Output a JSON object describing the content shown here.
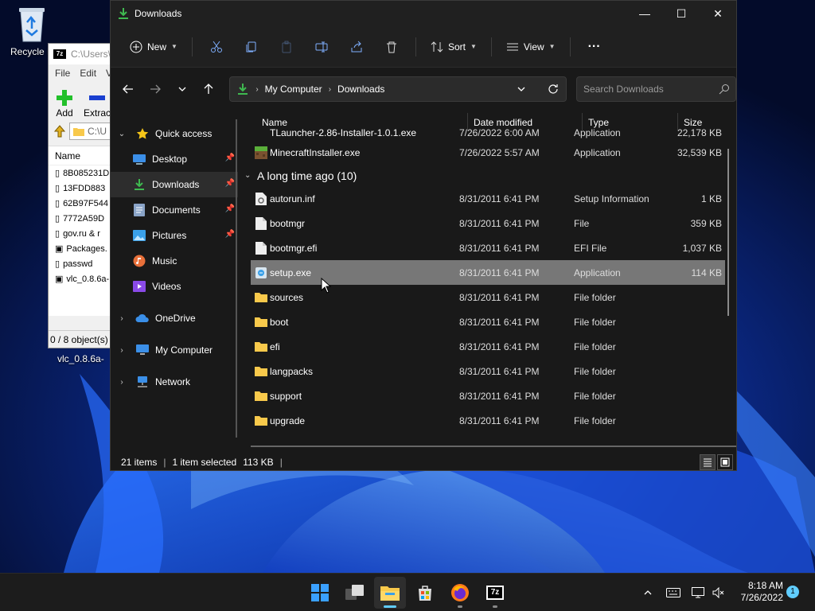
{
  "desktop": {
    "recycle_bin_label": "Recycle B",
    "vlc_file_label": "vlc_0.8.6a-"
  },
  "zip_window": {
    "title_path": "C:\\Users\\",
    "menu": [
      "File",
      "Edit",
      "V"
    ],
    "toolbar": {
      "add_label": "Add",
      "extract_label": "Extrac"
    },
    "path_value": "C:\\U",
    "column_name": "Name",
    "files": [
      "8B085231D",
      "13FDD883",
      "62B97F544",
      "7772A59D",
      "gov.ru & r",
      "Packages.",
      "passwd",
      "vlc_0.8.6a-"
    ],
    "status": "0 / 8 object(s)"
  },
  "explorer": {
    "title": "Downloads",
    "controls": {
      "minimize": "—",
      "maximize": "☐",
      "close": "✕"
    },
    "command_bar": {
      "new_label": "New",
      "sort_label": "Sort",
      "view_label": "View",
      "more_label": "···"
    },
    "address": {
      "crumbs": [
        "My Computer",
        "Downloads"
      ],
      "search_placeholder": "Search Downloads"
    },
    "nav_pane": {
      "quick_access": "Quick access",
      "items": [
        {
          "label": "Desktop",
          "pinned": true
        },
        {
          "label": "Downloads",
          "pinned": true
        },
        {
          "label": "Documents",
          "pinned": true
        },
        {
          "label": "Pictures",
          "pinned": true
        },
        {
          "label": "Music",
          "pinned": false
        },
        {
          "label": "Videos",
          "pinned": false
        }
      ],
      "onedrive": "OneDrive",
      "my_computer": "My Computer",
      "network": "Network",
      "pin_glyph": "📌"
    },
    "columns": {
      "name": "Name",
      "date": "Date modified",
      "type": "Type",
      "size": "Size"
    },
    "recent_files": [
      {
        "name": "TLauncher-2.86-Installer-1.0.1.exe",
        "date": "7/26/2022 6:00 AM",
        "type": "Application",
        "size": "22,178 KB"
      },
      {
        "name": "MinecraftInstaller.exe",
        "date": "7/26/2022 5:57 AM",
        "type": "Application",
        "size": "32,539 KB"
      }
    ],
    "group_header": "A long time ago (10)",
    "files": [
      {
        "name": "autorun.inf",
        "date": "8/31/2011 6:41 PM",
        "type": "Setup Information",
        "size": "1 KB"
      },
      {
        "name": "bootmgr",
        "date": "8/31/2011 6:41 PM",
        "type": "File",
        "size": "359 KB"
      },
      {
        "name": "bootmgr.efi",
        "date": "8/31/2011 6:41 PM",
        "type": "EFI File",
        "size": "1,037 KB"
      },
      {
        "name": "setup.exe",
        "date": "8/31/2011 6:41 PM",
        "type": "Application",
        "size": "114 KB"
      },
      {
        "name": "sources",
        "date": "8/31/2011 6:41 PM",
        "type": "File folder",
        "size": ""
      },
      {
        "name": "boot",
        "date": "8/31/2011 6:41 PM",
        "type": "File folder",
        "size": ""
      },
      {
        "name": "efi",
        "date": "8/31/2011 6:41 PM",
        "type": "File folder",
        "size": ""
      },
      {
        "name": "langpacks",
        "date": "8/31/2011 6:41 PM",
        "type": "File folder",
        "size": ""
      },
      {
        "name": "support",
        "date": "8/31/2011 6:41 PM",
        "type": "File folder",
        "size": ""
      },
      {
        "name": "upgrade",
        "date": "8/31/2011 6:41 PM",
        "type": "File folder",
        "size": ""
      }
    ],
    "status": {
      "items": "21 items",
      "selected": "1 item selected",
      "size": "113 KB"
    }
  },
  "taskbar": {
    "time": "8:18 AM",
    "date": "7/26/2022",
    "notification_count": "1",
    "zip_label": "7z"
  },
  "colors": {
    "accent": "#60cdff",
    "folder": "#f8c94b",
    "download_green": "#3fb950",
    "selected_row": "#777777"
  }
}
